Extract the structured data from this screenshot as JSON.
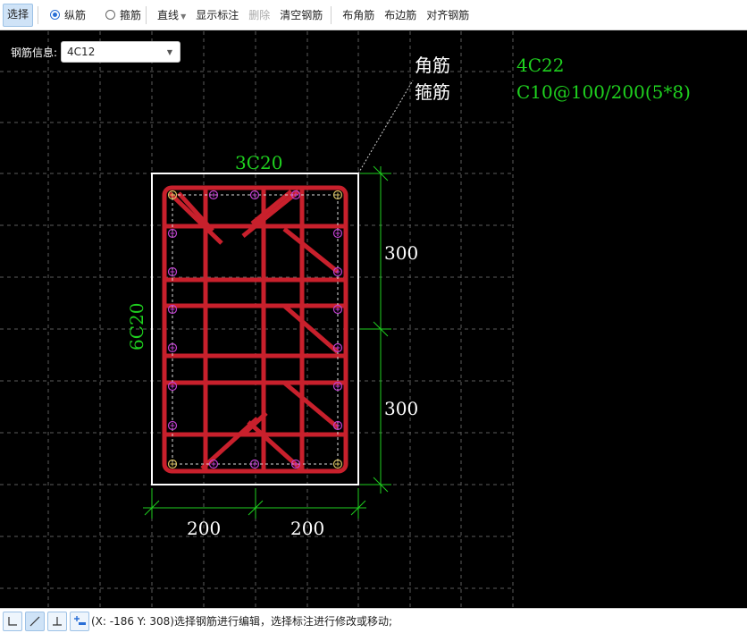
{
  "toolbar": {
    "select": "选择",
    "radio_longitudinal": "纵筋",
    "radio_stirrup": "箍筋",
    "line_dropdown": "直线",
    "show_dims": "显示标注",
    "delete": "删除",
    "clear_rebar": "清空钢筋",
    "corner_rebar": "布角筋",
    "edge_rebar": "布边筋",
    "align_rebar": "对齐钢筋"
  },
  "rebar_info": {
    "label": "钢筋信息:",
    "value": "4C12"
  },
  "drawing": {
    "legend_corner_label": "角筋",
    "legend_corner_value": "4C22",
    "legend_stirrup_label": "箍筋",
    "legend_stirrup_value": "C10@100/200(5*8)",
    "top_rebar": "3C20",
    "side_rebar": "6C20",
    "dim_right_upper": "300",
    "dim_right_lower": "300",
    "dim_bottom_left": "200",
    "dim_bottom_right": "200",
    "colors": {
      "rebar": "#c8202c",
      "annotation": "#1fd11f",
      "text": "#ffffff",
      "grid": "#5c5c5c",
      "bar_marker": "#c040d0",
      "corner_marker": "#d8c060"
    }
  },
  "status": {
    "text": "(X: -186 Y: 308)选择钢筋进行编辑，选择标注进行修改或移动;"
  }
}
